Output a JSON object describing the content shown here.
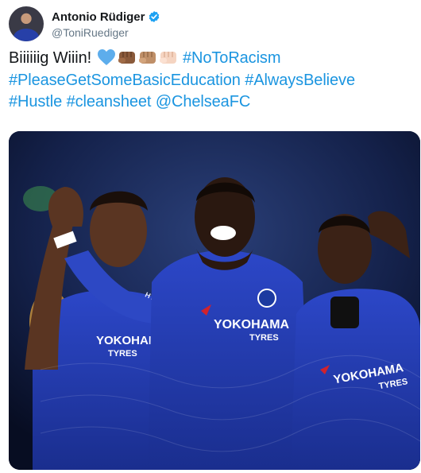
{
  "author": {
    "display_name": "Antonio Rüdiger",
    "handle": "@ToniRuediger",
    "verified_icon": "verified-badge-icon",
    "verified_color": "#1da1f2"
  },
  "tweet": {
    "text_start": "Biiiiiig Wiiin! ",
    "emojis": [
      "blue-heart-icon",
      "fist-dark-icon",
      "fist-medium-icon",
      "fist-light-icon"
    ],
    "hashtag_1": "#NoToRacism",
    "hashtag_2": "#PleaseGetSomeBasicEducation",
    "hashtag_3": "#AlwaysBelieve",
    "hashtag_4": "#Hustle",
    "hashtag_5": "#cleansheet",
    "mention": "@ChelseaFC",
    "link_color": "#1b95e0"
  },
  "media": {
    "sponsor_left": "YOKOHAMA",
    "sponsor_left_sub": "TYRES",
    "sponsor_center": "YOKOHAMA",
    "sponsor_center_sub": "TYRES",
    "sponsor_right": "YOKOHAMA",
    "sponsor_right_sub": "TYRES",
    "sleeve_sponsor": "HYUNDAI"
  }
}
